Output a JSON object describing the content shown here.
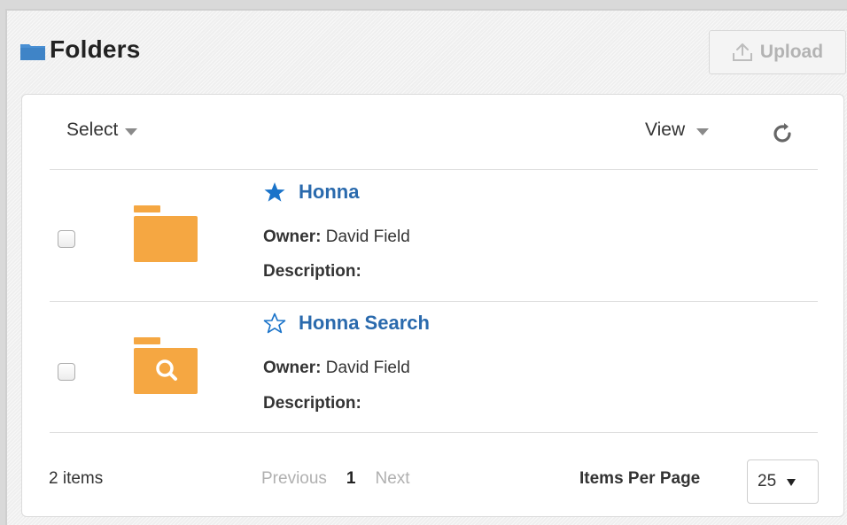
{
  "header": {
    "title": "Folders",
    "title_icon": "folder-icon",
    "upload_label": "Upload",
    "upload_icon": "upload-icon"
  },
  "toolbar": {
    "select_label": "Select",
    "view_label": "View",
    "refresh_icon": "refresh-icon"
  },
  "items": [
    {
      "name": "Honna",
      "favorite": true,
      "icon": "folder-icon",
      "owner_label": "Owner:",
      "owner": "David Field",
      "description_label": "Description:",
      "description": ""
    },
    {
      "name": "Honna Search",
      "favorite": false,
      "icon": "search-folder-icon",
      "owner_label": "Owner:",
      "owner": "David Field",
      "description_label": "Description:",
      "description": ""
    }
  ],
  "footer": {
    "item_count": "2 items",
    "previous_label": "Previous",
    "current_page": "1",
    "next_label": "Next",
    "items_per_page_label": "Items Per Page",
    "items_per_page_value": "25"
  },
  "colors": {
    "link": "#2a6aad",
    "folder": "#f5a742",
    "star": "#1a73c9",
    "header_folder_icon": "#4a90d4"
  }
}
